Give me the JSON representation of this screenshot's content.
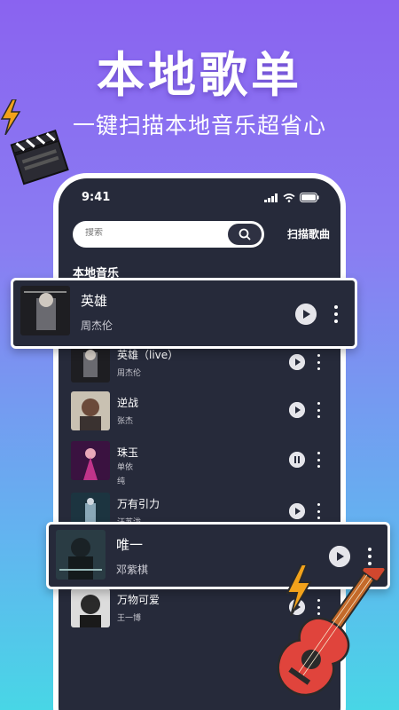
{
  "hero": {
    "title": "本地歌单",
    "subtitle": "一键扫描本地音乐超省心"
  },
  "status_bar": {
    "time": "9:41"
  },
  "search": {
    "placeholder": "搜索",
    "scan_label": "扫描歌曲"
  },
  "section": {
    "label": "本地音乐"
  },
  "featured_top": {
    "title": "英雄",
    "artist": "周杰伦"
  },
  "featured_bottom": {
    "title": "唯一",
    "artist": "邓紫棋"
  },
  "songs": [
    {
      "title": "英雄（live）",
      "artist": "周杰伦",
      "state": "play"
    },
    {
      "title": "逆战",
      "artist": "张杰",
      "state": "play"
    },
    {
      "title": "珠玉",
      "artist": "单依纯",
      "state": "pause"
    },
    {
      "title": "万有引力",
      "artist": "汪苏泷",
      "state": "play"
    },
    {
      "title": "万物可爱",
      "artist": "王一博",
      "state": "play"
    }
  ],
  "colors": {
    "background_top": "#8a63f0",
    "background_bottom": "#48d6e6",
    "screen": "#262a3a",
    "accent_guitar": "#e0443c",
    "bolt": "#f2a21b"
  },
  "icons": [
    "signal-icon",
    "wifi-icon",
    "battery-icon",
    "search-icon",
    "play-icon",
    "pause-icon",
    "more-icon",
    "clapperboard-icon",
    "lightning-icon",
    "guitar-icon"
  ]
}
